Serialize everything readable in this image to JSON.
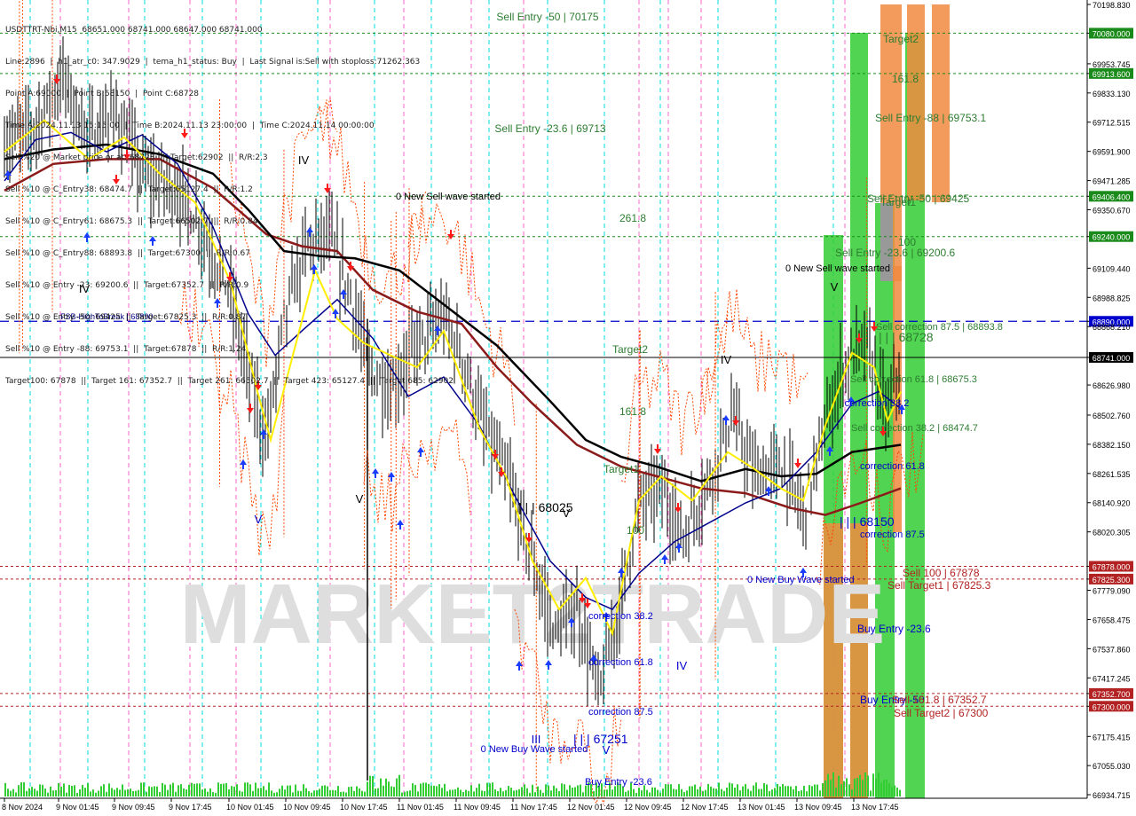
{
  "header": {
    "lines": [
      "USDTTRT-Nbi,M15  68651.000 68741.000 68647.000 68741.000",
      "Line:2896  |  h1_atr_c0: 347.9029  |  tema_h1_status: Buy  |  Last Signal is:Sell with stoploss:71262.363",
      "Point A:69000  |  Point B:68150  |  Point C:68728",
      "Time A:2024.11.13 15:15:00  |  Time B:2024.11.13 23:00:00  |  Time C:2024.11.14 00:00:00",
      "Sell %20 @ Market price or at: 68728  ||  Target:62902  ||  R/R:2.3",
      "Sell %10 @ C_Entry38: 68474.7  ||  Target:65127.4  ||  R/R:1.2",
      "Sell %10 @ C_Entry61: 68675.3  ||  Target:66502.7  ||  R/R:0.84",
      "Sell %10 @ C_Entry88: 68893.8  ||  Target:67300  ||  R/R:0.67",
      "Sell %10 @ Entry -23: 69200.6  ||  Target:67352.7  ||  R/R:0.9",
      "Sell %10 @ Entry -50: 69425  ||  Target:67825.3  ||  R/R:0.87",
      "Sell %10 @ Entry -88: 69753.1  ||  Target:67878  ||  R/R:1.24",
      "Target100: 67878  ||  Target 161: 67352.7  ||  Target 261: 66502.7  ||  Target 423: 65127.4  ||  Target 685: 62902"
    ]
  },
  "watermark": "MARKET2TRADE",
  "chart_data": {
    "type": "candlestick",
    "symbol": "USDTTRT-Nbi",
    "timeframe": "M15",
    "ylim": [
      66934.715,
      70198.83
    ],
    "y_ticks": [
      "70198.830",
      "70080.000",
      "69953.745",
      "69913.600",
      "69833.130",
      "69712.515",
      "69591.900",
      "69471.285",
      "69406.400",
      "69350.670",
      "69240.000",
      "69109.440",
      "68988.825",
      "68890.000",
      "68868.210",
      "68741.000",
      "68626.980",
      "68502.760",
      "68382.150",
      "68261.535",
      "68140.920",
      "68020.305",
      "67878.000",
      "67825.300",
      "67779.090",
      "67658.475",
      "67537.860",
      "67417.245",
      "67352.700",
      "67300.000",
      "67175.415",
      "67055.030",
      "66934.715"
    ],
    "x_ticks": [
      "8 Nov 2024",
      "9 Nov 01:45",
      "9 Nov 09:45",
      "9 Nov 17:45",
      "10 Nov 01:45",
      "10 Nov 09:45",
      "10 Nov 17:45",
      "11 Nov 01:45",
      "11 Nov 09:45",
      "11 Nov 17:45",
      "12 Nov 01:45",
      "12 Nov 09:45",
      "12 Nov 17:45",
      "13 Nov 01:45",
      "13 Nov 09:45",
      "13 Nov 17:45"
    ],
    "price_levels": [
      {
        "value": 70080.0,
        "label": "70080.000",
        "color": "#1a8a1a",
        "style": "dash"
      },
      {
        "value": 69913.6,
        "label": "69913.600",
        "color": "#1a8a1a",
        "style": "dash"
      },
      {
        "value": 69406.4,
        "label": "69406.400",
        "color": "#1a8a1a",
        "style": "dash"
      },
      {
        "value": 69240.0,
        "label": "69240.000",
        "color": "#1a8a1a",
        "style": "dash"
      },
      {
        "value": 68890.0,
        "label": "68890.000",
        "color": "#0000cc",
        "style": "longdash"
      },
      {
        "value": 68741.0,
        "label": "68741.000",
        "color": "#000000",
        "style": "solid"
      },
      {
        "value": 67878.0,
        "label": "67878.000",
        "color": "#b22222",
        "style": "dash"
      },
      {
        "value": 67825.3,
        "label": "67825.300",
        "color": "#b22222",
        "style": "dash"
      },
      {
        "value": 67352.7,
        "label": "67352.700",
        "color": "#b22222",
        "style": "dash"
      },
      {
        "value": 67300.0,
        "label": "67300.000",
        "color": "#b22222",
        "style": "dash"
      }
    ],
    "annotations": [
      {
        "text": "Sell Entry -50 | 70175",
        "color": "#2e7d32"
      },
      {
        "text": "Sell Entry -23.6 | 69713",
        "color": "#2e7d32"
      },
      {
        "text": "0 New Sell wave started",
        "color": "#000000"
      },
      {
        "text": "261.8",
        "color": "#2e7d32"
      },
      {
        "text": "FSB-HighToBreak | 68890",
        "color": "#000080"
      },
      {
        "text": "Target2",
        "color": "#2e7d32"
      },
      {
        "text": "161.8",
        "color": "#2e7d32"
      },
      {
        "text": "Target1",
        "color": "#2e7d32"
      },
      {
        "text": "100",
        "color": "#2e7d32"
      },
      {
        "text": "| | | 68025",
        "color": "#000000"
      },
      {
        "text": "correction 38.2",
        "color": "#0000cc"
      },
      {
        "text": "correction 61.8",
        "color": "#0000cc"
      },
      {
        "text": "correction 87.5",
        "color": "#0000cc"
      },
      {
        "text": "0 New Buy Wave started",
        "color": "#0000cc"
      },
      {
        "text": "| | | 67251",
        "color": "#0000cc"
      },
      {
        "text": "Buy Entry -23.6",
        "color": "#0000cc"
      },
      {
        "text": "0 New Buy Wave started",
        "color": "#0000cc"
      },
      {
        "text": "Target2",
        "color": "#2e7d32"
      },
      {
        "text": "161.8",
        "color": "#2e7d32"
      },
      {
        "text": "Sell Entry -88 | 69753.1",
        "color": "#2e7d32"
      },
      {
        "text": "Sell Entry -50 | 69425",
        "color": "#2e7d32"
      },
      {
        "text": "Target1",
        "color": "#2e7d32"
      },
      {
        "text": "100",
        "color": "#2e7d32"
      },
      {
        "text": "Sell Entry -23.6 | 69200.6",
        "color": "#2e7d32"
      },
      {
        "text": "0 New Sell wave started",
        "color": "#000000"
      },
      {
        "text": "Sell correction 87.5 | 68893.8",
        "color": "#2e7d32"
      },
      {
        "text": "| | | 68728",
        "color": "#2e7d32"
      },
      {
        "text": "Sell correction 61.8 | 68675.3",
        "color": "#2e7d32"
      },
      {
        "text": "correction 38.2",
        "color": "#0000cc"
      },
      {
        "text": "Sell correction 38.2 | 68474.7",
        "color": "#2e7d32"
      },
      {
        "text": "correction 61.8",
        "color": "#0000cc"
      },
      {
        "text": "| | | 68150",
        "color": "#0000cc"
      },
      {
        "text": "correction 87.5",
        "color": "#0000cc"
      },
      {
        "text": "Sell 100 | 67878",
        "color": "#b22222"
      },
      {
        "text": "Sell Target1 | 67825.3",
        "color": "#b22222"
      },
      {
        "text": "Buy Entry -23.6",
        "color": "#0000cc"
      },
      {
        "text": "Buy Entry -50",
        "color": "#0000cc"
      },
      {
        "text": "Sell 161.8 | 67352.7",
        "color": "#b22222"
      },
      {
        "text": "Sell Target2 | 67300",
        "color": "#b22222"
      }
    ],
    "wave_labels": [
      "IV",
      "IV",
      "V",
      "V",
      "IV",
      "V",
      "V",
      "IV",
      "V",
      "III"
    ],
    "colors": {
      "candle": "#000000",
      "ma_black": "#000000",
      "ma_darkred": "#8b1a1a",
      "ma_navy": "#00008b",
      "ma_yellow": "#ffee00",
      "bands": "#ff4500",
      "volume": "#32cd32",
      "green_zone": "#33cc33",
      "orange_zone": "#f08a40"
    }
  }
}
